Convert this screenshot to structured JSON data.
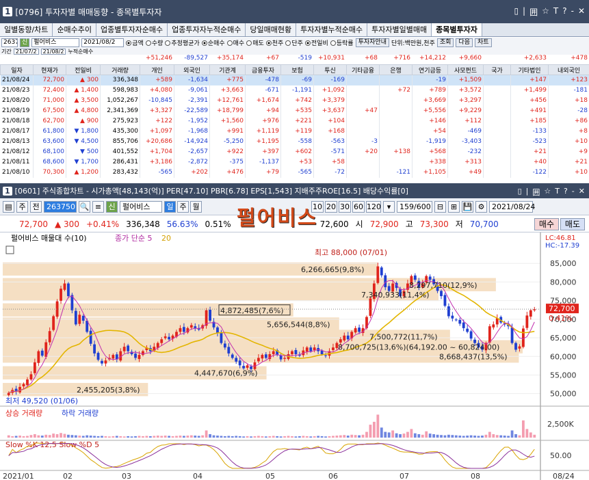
{
  "window": {
    "num": "1",
    "title": "[0796] 투자자별 매매동향 - 종목별투자자",
    "controls": [
      "▯",
      "|",
      "囲",
      "☆",
      "T",
      "?",
      "-",
      "✕"
    ]
  },
  "tabs": [
    {
      "label": "일별동향/차트"
    },
    {
      "label": "순매수추이"
    },
    {
      "label": "업종별투자자순매수"
    },
    {
      "label": "업종투자자누적순매수"
    },
    {
      "label": "당일매매현황"
    },
    {
      "label": "투자자별누적순매수"
    },
    {
      "label": "투자자별일별매매"
    },
    {
      "label": "종목별투자자",
      "active": true
    }
  ],
  "toolbar1": {
    "code": "263750",
    "name": "펄어비스",
    "date": "2021/08/2",
    "radios1": [
      {
        "label": "금액",
        "on": true
      },
      {
        "label": "수량",
        "on": false
      },
      {
        "label": "추정평균가",
        "on": false
      }
    ],
    "radios2": [
      {
        "label": "순매수",
        "on": true
      },
      {
        "label": "매수",
        "on": false
      },
      {
        "label": "매도",
        "on": false
      }
    ],
    "radios3": [
      {
        "label": "천주",
        "on": true
      },
      {
        "label": "단주",
        "on": false
      }
    ],
    "radios4": [
      {
        "label": "전일비",
        "on": true
      },
      {
        "label": "등락률",
        "on": false
      }
    ],
    "btn_investor": "투자자안내",
    "unit": "단위:백만원,천주",
    "btn_query": "조회",
    "btn_next": "다음",
    "btn_chart": "차트"
  },
  "period": {
    "label": "기간",
    "from": "21/07/2",
    "to": "21/08/2",
    "cum_label": "누적순매수"
  },
  "summary": [
    "+51,246",
    "-89,527",
    "+35,174",
    "+67",
    "-519",
    "+10,931",
    "+68",
    "+716",
    "+14,212",
    "+9,660",
    "",
    "+2,633",
    "+478"
  ],
  "headers": [
    "일자",
    "현재가",
    "전일비",
    "거래량",
    "개인",
    "외국인",
    "기관계",
    "금융투자",
    "보험",
    "투신",
    "기타금융",
    "은행",
    "연기금등",
    "사모펀드",
    "국가",
    "기타법인",
    "내외국인"
  ],
  "rows": [
    [
      "21/08/24",
      "72,700",
      "▲ 300",
      "336,348",
      "+589",
      "-1,634",
      "+775",
      "-478",
      "-69",
      "-169",
      "",
      "",
      "-19",
      "+1,509",
      "",
      "+147",
      "+123"
    ],
    [
      "21/08/23",
      "72,400",
      "▲ 1,400",
      "598,983",
      "+4,080",
      "-9,061",
      "+3,663",
      "-671",
      "-1,191",
      "+1,092",
      "",
      "+72",
      "+789",
      "+3,572",
      "",
      "+1,499",
      "-181"
    ],
    [
      "21/08/20",
      "71,000",
      "▲ 3,500",
      "1,052,267",
      "-10,845",
      "-2,391",
      "+12,761",
      "+1,674",
      "+742",
      "+3,379",
      "",
      "",
      "+3,669",
      "+3,297",
      "",
      "+456",
      "+18"
    ],
    [
      "21/08/19",
      "67,500",
      "▲ 4,800",
      "2,341,369",
      "+3,327",
      "-22,589",
      "+18,799",
      "+94",
      "+535",
      "+3,637",
      "+47",
      "",
      "+5,556",
      "+9,229",
      "",
      "+491",
      "-28"
    ],
    [
      "21/08/18",
      "62,700",
      "▲ 900",
      "275,923",
      "+122",
      "-1,952",
      "+1,560",
      "+976",
      "+221",
      "+104",
      "",
      "",
      "+146",
      "+112",
      "",
      "+185",
      "+86"
    ],
    [
      "21/08/17",
      "61,800",
      "▼ 1,800",
      "435,300",
      "+1,097",
      "-1,968",
      "+991",
      "+1,119",
      "+119",
      "+168",
      "",
      "",
      "+54",
      "-469",
      "",
      "-133",
      "+8"
    ],
    [
      "21/08/13",
      "63,600",
      "▼ 4,500",
      "855,706",
      "+20,686",
      "-14,924",
      "-5,250",
      "+1,195",
      "-558",
      "-563",
      "-3",
      "",
      "-1,919",
      "-3,403",
      "",
      "-523",
      "+10"
    ],
    [
      "21/08/12",
      "68,100",
      "▼ 500",
      "401,552",
      "+1,704",
      "-2,657",
      "+922",
      "+397",
      "+602",
      "-571",
      "+20",
      "+138",
      "+568",
      "-232",
      "",
      "+21",
      "+9"
    ],
    [
      "21/08/11",
      "68,600",
      "▼ 1,700",
      "286,431",
      "+3,186",
      "-2,872",
      "-375",
      "-1,137",
      "+53",
      "+58",
      "",
      "",
      "+338",
      "+313",
      "",
      "+40",
      "+21"
    ],
    [
      "21/08/10",
      "70,300",
      "▲ 1,200",
      "283,432",
      "-565",
      "+202",
      "+476",
      "+79",
      "-565",
      "-72",
      "",
      "-121",
      "+1,105",
      "+49",
      "",
      "-122",
      "+10"
    ]
  ],
  "chartwin": {
    "num": "1",
    "title": "[0601] 주식종합차트 - 시가총액[48,143(억)] PER[47.10] PBR[6.78] EPS[1,543] 지배주주ROE[16.5] 배당수익률[0]",
    "code": "263750",
    "name_box": "펄어비스",
    "periods": [
      "일",
      "주",
      "월"
    ],
    "ticks": [
      "10",
      "20",
      "30",
      "60",
      "120"
    ],
    "count": "159/600",
    "date": "2021/08/24",
    "overlay_name": "펄어비스"
  },
  "price": {
    "current": "72,700",
    "change": "▲ 300",
    "pct": "+0.41%",
    "volume": "336,348",
    "ratio1": "56.63%",
    "ratio2": "0.51%",
    "prev": "72,600",
    "open_label": "시",
    "open": "72,900",
    "high_label": "고",
    "high": "73,300",
    "low_label": "저",
    "low": "70,700",
    "buy": "매수",
    "sell": "매도"
  },
  "chart_data": [
    {
      "type": "candlestick",
      "title": "펄어비스 매물대 수(10)",
      "legend": [
        "종가 단순 5",
        "20"
      ],
      "ylim": [
        47000,
        90000
      ],
      "y_ticks": [
        50000,
        55000,
        60000,
        65000,
        70000,
        75000,
        80000,
        85000
      ],
      "y_tick_labels": [
        "50,000",
        "55,000",
        "60,000",
        "65,000",
        "70,000",
        "75,000",
        "80,000",
        "85,000"
      ],
      "x_labels": [
        "2021/01",
        "02",
        "03",
        "04",
        "05",
        "06",
        "07",
        "08",
        "08/24"
      ],
      "lc": "LC:46.81",
      "hc": "HC:-17.39",
      "current_tag": "72,700",
      "current_pct": "0.41%",
      "high_annot": "최고 88,000 (07/01)",
      "low_annot": "최저 49,520 (01/06)",
      "volume_profile": [
        {
          "label": "2,455,205(3,8%)",
          "price": 51000,
          "pct": 3.8
        },
        {
          "label": "4,447,670(6,9%)",
          "price": 55500,
          "pct": 6.9
        },
        {
          "label": "8,668,437(13,5%)",
          "price": 60000,
          "pct": 13.5
        },
        {
          "label": "8,700,725(13,6%)(64,192.00 ~ 60,824.00)",
          "price": 62500,
          "pct": 13.6
        },
        {
          "label": "7,500,772(11,7%)",
          "price": 65300,
          "pct": 11.7
        },
        {
          "label": "5,656,544(8,8%)",
          "price": 68600,
          "pct": 8.8
        },
        {
          "label": "4,872,485(7,6%)",
          "price": 72400,
          "pct": 7.6
        },
        {
          "label": "7,340,933(11,4%)",
          "price": 76600,
          "pct": 11.4
        },
        {
          "label": "8,297,710(12,9%)",
          "price": 79200,
          "pct": 12.9
        },
        {
          "label": "6,266,665(9,8%)",
          "price": 83400,
          "pct": 9.8
        }
      ],
      "closes": [
        50200,
        51000,
        50500,
        51800,
        52600,
        53800,
        55200,
        58400,
        61400,
        60200,
        63800,
        66800,
        70800,
        74800,
        78200,
        79600,
        76200,
        72400,
        68600,
        71200,
        69600,
        66600,
        63400,
        60800,
        59100,
        58100,
        58900,
        59600,
        60400,
        59200,
        61400,
        62600,
        61400,
        60600,
        59600,
        60400,
        61400,
        62400,
        61400,
        62600,
        63600,
        64600,
        65400,
        64600,
        65600,
        66600,
        67600,
        66600,
        67600,
        68400,
        67600,
        67200,
        68400,
        72400,
        69600,
        67800,
        66200,
        63600,
        62400,
        60800,
        59600,
        58600,
        57600,
        56800,
        57600,
        56600,
        58400,
        59600,
        60400,
        59600,
        60600,
        61400,
        60400,
        59200,
        59600,
        60600,
        61400,
        60600,
        60200,
        61600,
        62400,
        61400,
        62400,
        61400,
        60600,
        60200,
        61400,
        62400,
        63600,
        64600,
        65600,
        64600,
        66600,
        67600,
        66600,
        67600,
        70600,
        75600,
        79600,
        84200,
        81800,
        78600,
        77600,
        79600,
        78400,
        76200,
        77600,
        79600,
        81600,
        80600,
        78600,
        79600,
        81600,
        80600,
        79400,
        77600,
        76200,
        73600,
        70800,
        70200,
        69800,
        68800,
        67600,
        66600,
        64800,
        63600,
        62400,
        61800,
        63600,
        68100,
        68600,
        70300,
        69100,
        68600,
        68100,
        63600,
        61800,
        62700,
        67500,
        71000,
        72400,
        72700
      ],
      "ma5_note": "pink moving average",
      "ma20_note": "orange moving average"
    },
    {
      "type": "bar",
      "title": "상승 거래량 하락 거래량",
      "y_tick_labels": [
        "2,500K"
      ],
      "volumes": [
        0.08,
        0.05,
        0.06,
        0.07,
        0.05,
        0.06,
        0.09,
        0.12,
        0.08,
        0.07,
        0.1,
        0.09,
        0.14,
        0.12,
        0.16,
        0.13,
        0.1,
        0.09,
        0.08,
        0.07,
        0.06,
        0.08,
        0.07,
        0.06,
        0.05,
        0.06,
        0.05,
        0.04,
        0.05,
        0.06,
        0.05,
        0.04,
        0.05,
        0.04,
        0.05,
        0.06,
        0.05,
        0.06,
        0.05,
        0.06,
        0.07,
        0.06,
        0.07,
        0.06,
        0.05,
        0.06,
        0.07,
        0.06,
        0.07,
        0.08,
        0.07,
        0.06,
        0.08,
        0.25,
        0.12,
        0.08,
        0.07,
        0.06,
        0.05,
        0.06,
        0.05,
        0.06,
        0.05,
        0.04,
        0.05,
        0.04,
        0.05,
        0.06,
        0.05,
        0.04,
        0.05,
        0.06,
        0.05,
        0.04,
        0.05,
        0.06,
        0.05,
        0.04,
        0.05,
        0.06,
        0.05,
        0.04,
        0.05,
        0.06,
        0.05,
        0.04,
        0.05,
        0.06,
        0.07,
        0.08,
        0.09,
        0.07,
        0.1,
        0.09,
        0.08,
        0.1,
        0.2,
        0.45,
        0.55,
        0.8,
        0.35,
        0.2,
        0.18,
        0.25,
        0.15,
        0.12,
        0.14,
        0.2,
        0.3,
        0.15,
        0.12,
        0.1,
        0.22,
        0.14,
        0.12,
        0.1,
        0.09,
        0.08,
        0.1,
        0.09,
        0.08,
        0.07,
        0.06,
        0.07,
        0.08,
        0.07,
        0.06,
        0.07,
        0.1,
        0.2,
        0.12,
        0.09,
        0.08,
        0.07,
        0.06,
        0.25,
        0.12,
        0.08,
        0.6,
        0.3,
        0.18,
        0.1
      ]
    },
    {
      "type": "line",
      "title": "Slow %K 12,5 Slow %D 5",
      "y_tick_labels": [
        "50.00"
      ]
    }
  ]
}
